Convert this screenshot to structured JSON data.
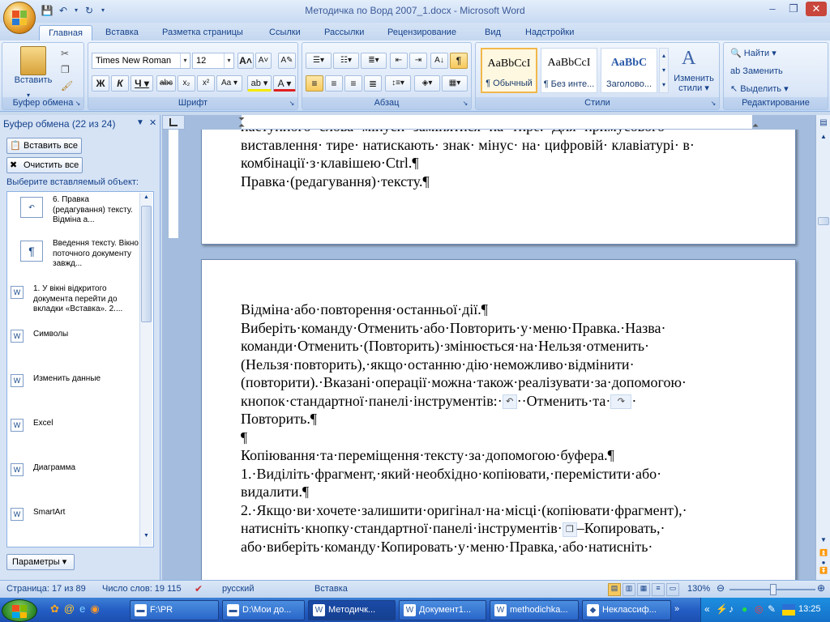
{
  "window": {
    "title": "Методичка по Ворд 2007_1.docx - Microsoft Word"
  },
  "ribbon_tabs": [
    "Главная",
    "Вставка",
    "Разметка страницы",
    "Ссылки",
    "Рассылки",
    "Рецензирование",
    "Вид",
    "Надстройки"
  ],
  "clipboard_group": {
    "label": "Буфер обмена",
    "paste_label": "Вставить"
  },
  "font_group": {
    "label": "Шрифт",
    "font_name": "Times New Roman",
    "font_size": "12"
  },
  "paragraph_group": {
    "label": "Абзац"
  },
  "styles_group": {
    "label": "Стили",
    "tiles": [
      {
        "preview": "AaBbCcI",
        "name": "¶ Обычный"
      },
      {
        "preview": "AaBbCcI",
        "name": "¶ Без инте..."
      },
      {
        "preview": "AaBbC",
        "name": "Заголово..."
      }
    ],
    "change_styles_line1": "Изменить",
    "change_styles_line2": "стили"
  },
  "editing_group": {
    "label": "Редактирование",
    "find": "Найти",
    "replace": "Заменить",
    "select": "Выделить"
  },
  "task_pane": {
    "title": "Буфер обмена (22 из 24)",
    "paste_all": "Вставить все",
    "clear_all": "Очистить все",
    "choose_label": "Выберите вставляемый объект:",
    "items": [
      "6. Правка (редагування) тексту. Відміна а...",
      "Введення тексту. Вікно поточного документу завжд...",
      "1. У вікні відкритого документа перейти до вкладки «Вставка». 2....",
      "Символы",
      "Изменить данные",
      "Excel",
      "Диаграмма",
      "SmartArt"
    ],
    "options_button": "Параметры"
  },
  "document": {
    "page1_lines": [
      "наступного· слова· мінуси· замінятися· на· тире.· Для· примусового·",
      "виставлення· тире· натискають· знак· мінус· на· цифровій· клавіатурі· в·",
      "комбінації·з·клавішею·Ctrl.¶",
      "Правка·(редагування)·тексту.¶"
    ],
    "page2_lines": [
      "Відміна·або·повторення·останньої·дії.¶",
      "Виберіть·команду·Отменить·або·Повторить·у·меню·Правка.·Назва·",
      "команди·Отменить·(Повторить)·змінюється·на·Нельзя·отменить·",
      "(Нельзя·повторить),·якщо·останню·дію·неможливо·відмінити·",
      "(повторити).·Вказані·операції·можна·також·реалізувати·за·допомогою·",
      "кнопок·стандартної·панелі·інструментів:·",
      "··Отменить·та·",
      "·",
      "Повторить.¶",
      "¶",
      "Копіювання·та·переміщення·тексту·за·допомогою·буфера.¶",
      "1.·Виділіть·фрагмент,·який·необхідно·копіювати,·перемістити·або·",
      "видалити.¶",
      "2.·Якщо·ви·хочете·залишити·оригінал·на·місці·(копіювати·фрагмент),·",
      "натисніть·кнопку·стандартної·панелі·інструментів·",
      "–Копировать,·",
      "або·виберіть·команду·Копировать·у·меню·Правка,·або·натисніть·"
    ]
  },
  "status_bar": {
    "page": "Страница: 17 из 89",
    "words": "Число слов: 19 115",
    "language": "русский",
    "mode": "Вставка",
    "zoom": "130%"
  },
  "taskbar": {
    "items": [
      "F:\\PR",
      "D:\\Мои до...",
      "Методичк...",
      "Документ1...",
      "methodichka...",
      "Неклассиф..."
    ],
    "clock": "13:25"
  }
}
